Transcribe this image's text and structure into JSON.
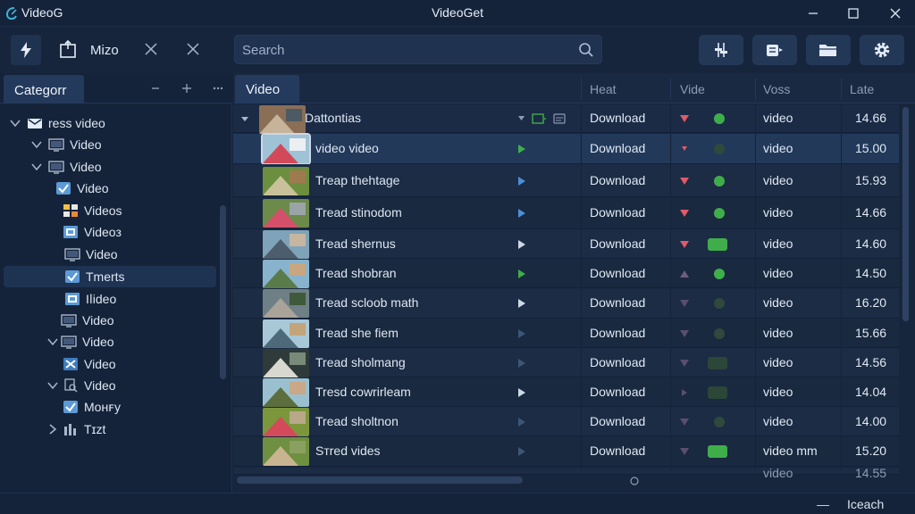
{
  "titlebar": {
    "app_name": "VideoG",
    "window_title": "VideoGet"
  },
  "toolbar": {
    "label": "Mizo",
    "search_placeholder": "Search"
  },
  "left_panel": {
    "tab_label": "Categorr",
    "tree": [
      {
        "label": "ress video",
        "icon": "mail-icon",
        "twisty": "expanded"
      },
      {
        "label": "Video",
        "icon": "monitor-icon",
        "twisty": "expanded"
      },
      {
        "label": "Video",
        "icon": "monitor-icon",
        "twisty": "expanded"
      },
      {
        "label": "Video",
        "icon": "checkbox-icon",
        "twisty": "none"
      },
      {
        "label": "Videos",
        "icon": "grid-icon",
        "twisty": "none"
      },
      {
        "label": "Videoз",
        "icon": "film-icon",
        "twisty": "none"
      },
      {
        "label": "Video",
        "icon": "monitor-icon",
        "twisty": "none"
      },
      {
        "label": "Tmerts",
        "icon": "checkbox-icon",
        "twisty": "none",
        "selected": true
      },
      {
        "label": "Iⅼideo",
        "icon": "film-icon",
        "twisty": "none"
      },
      {
        "label": "Video",
        "icon": "monitor-icon",
        "twisty": "none"
      },
      {
        "label": "Video",
        "icon": "monitor-icon",
        "twisty": "expanded"
      },
      {
        "label": "Video",
        "icon": "tools-icon",
        "twisty": "none"
      },
      {
        "label": "Video",
        "icon": "search-doc-icon",
        "twisty": "expanded"
      },
      {
        "label": "Mᴏʜꜰy",
        "icon": "checkbox-icon",
        "twisty": "none"
      },
      {
        "label": "Tɪzt",
        "icon": "bars-icon",
        "twisty": "collapsed"
      }
    ]
  },
  "columns": {
    "tab": "Video",
    "heat": "Heat",
    "vide": "Vide",
    "voss": "Voss",
    "late": "Late"
  },
  "rows": [
    {
      "name": "Dattontias",
      "status": "Download",
      "type": "video",
      "rate": "14.66",
      "tri": "down-red",
      "mark": "dot-green",
      "play": "",
      "parent": true
    },
    {
      "name": "video video",
      "status": "Download",
      "type": "video",
      "rate": "15.00",
      "tri": "small-red",
      "mark": "dot-dark",
      "play": "green"
    },
    {
      "name": "Treap thehtage",
      "status": "Download",
      "type": "video",
      "rate": "15.93",
      "tri": "down-red",
      "mark": "dot-green",
      "play": "blue"
    },
    {
      "name": "Tread stinodom",
      "status": "Download",
      "type": "video",
      "rate": "14.66",
      "tri": "down-red",
      "mark": "dot-green",
      "play": "blue"
    },
    {
      "name": "Tread shernus",
      "status": "Download",
      "type": "video",
      "rate": "14.60",
      "tri": "down-red",
      "mark": "pill-green",
      "play": "white"
    },
    {
      "name": "Tread shobran",
      "status": "Download",
      "type": "video",
      "rate": "14.50",
      "tri": "up-dim",
      "mark": "dot-green",
      "play": "green"
    },
    {
      "name": "Tread scloob math",
      "status": "Download",
      "type": "video",
      "rate": "16.20",
      "tri": "down-dim",
      "mark": "dot-dark",
      "play": "white"
    },
    {
      "name": "Tread she fiem",
      "status": "Download",
      "type": "video",
      "rate": "15.66",
      "tri": "down-dim",
      "mark": "dot-dark",
      "play": "dim"
    },
    {
      "name": "Tread sholmang",
      "status": "Download",
      "type": "video",
      "rate": "14.56",
      "tri": "down-dim",
      "mark": "pill-dark",
      "play": "dim"
    },
    {
      "name": "Tresd cowrirleam",
      "status": "Download",
      "type": "video",
      "rate": "14.04",
      "tri": "right-dim",
      "mark": "pill-dark",
      "play": "white"
    },
    {
      "name": "Tread sholtnon",
      "status": "Download",
      "type": "video",
      "rate": "14.00",
      "tri": "down-dim",
      "mark": "dot-dark",
      "play": "dim"
    },
    {
      "name": "Sтred vides",
      "status": "Download",
      "type": "video mm",
      "rate": "15.20",
      "tri": "down-dim",
      "mark": "pill-green",
      "play": "dim"
    }
  ],
  "partial_row": {
    "type": "video",
    "rate": "14.55"
  },
  "statusbar": {
    "dash": "—",
    "text": "Iceach"
  },
  "colors": {
    "background": "#162338",
    "accent_green": "#3fae4a",
    "accent_red": "#e05a6a",
    "accent_blue": "#4a8fd8"
  }
}
